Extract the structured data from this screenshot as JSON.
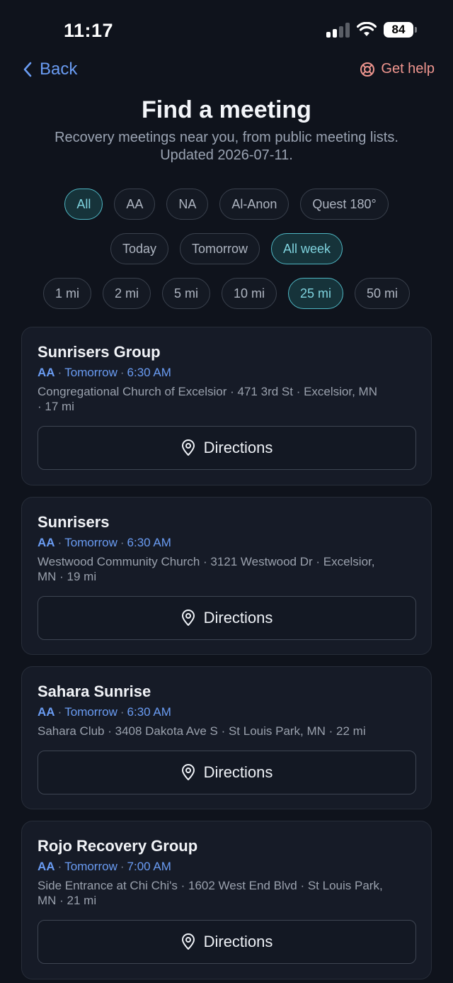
{
  "status": {
    "time": "11:17",
    "battery": "84"
  },
  "nav": {
    "back_label": "Back",
    "help_label": "Get help"
  },
  "header": {
    "title": "Find a meeting",
    "subtitle_line1": "Recovery meetings near you, from public meeting lists.",
    "subtitle_line2": "Updated 2026-07-11."
  },
  "filters": {
    "types": [
      "All",
      "AA",
      "NA",
      "Al-Anon",
      "Quest 180°"
    ],
    "types_selected": "All",
    "days": [
      "Today",
      "Tomorrow",
      "All week"
    ],
    "days_selected": "All week",
    "distances": [
      "1 mi",
      "2 mi",
      "5 mi",
      "10 mi",
      "25 mi",
      "50 mi"
    ],
    "distances_selected": "25 mi"
  },
  "meetings": [
    {
      "name": "Sunrisers Group",
      "fellowship": "AA",
      "day": "Tomorrow",
      "time": "6:30 AM",
      "address_line1": "Congregational Church of Excelsior · 471 3rd St · Excelsior, MN",
      "address_line2": "· 17 mi",
      "button": "Directions"
    },
    {
      "name": "Sunrisers",
      "fellowship": "AA",
      "day": "Tomorrow",
      "time": "6:30 AM",
      "address_line1": "Westwood Community Church · 3121 Westwood Dr · Excelsior,",
      "address_line2": "MN · 19 mi",
      "button": "Directions"
    },
    {
      "name": "Sahara Sunrise",
      "fellowship": "AA",
      "day": "Tomorrow",
      "time": "6:30 AM",
      "address_line1": "Sahara Club · 3408 Dakota Ave S · St Louis Park, MN · 22 mi",
      "address_line2": "",
      "button": "Directions"
    },
    {
      "name": "Rojo Recovery Group",
      "fellowship": "AA",
      "day": "Tomorrow",
      "time": "7:00 AM",
      "address_line1": "Side Entrance at Chi Chi's · 1602 West End Blvd · St Louis Park,",
      "address_line2": "MN · 21 mi",
      "button": "Directions"
    }
  ],
  "colors": {
    "accent": "#6a9cf3",
    "active_chip": "#4fb7c4",
    "help": "#f0968f",
    "background": "#0f131c"
  }
}
